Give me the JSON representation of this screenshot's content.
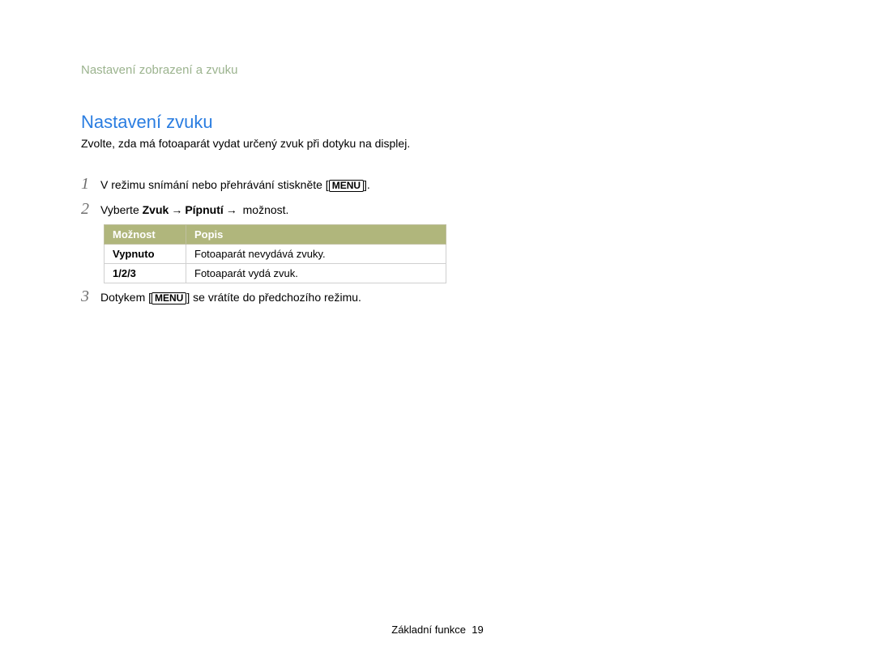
{
  "header": {
    "section": "Nastavení zobrazení a zvuku"
  },
  "content": {
    "heading": "Nastavení zvuku",
    "intro": "Zvolte, zda má fotoaparát vydat určený zvuk při dotyku na displej.",
    "steps": {
      "s1_num": "1",
      "s1_pre": "V režimu snímání nebo přehrávání stiskněte [",
      "s1_menu": "MENU",
      "s1_post": "].",
      "s2_num": "2",
      "s2_pre": "Vyberte ",
      "s2_b1": "Zvuk",
      "s2_arrow1": "→",
      "s2_b2": "Pípnutí",
      "s2_arrow2": "→",
      "s2_post": " možnost.",
      "s3_num": "3",
      "s3_pre": "Dotykem [",
      "s3_menu": "MENU",
      "s3_post": "] se vrátíte do předchozího režimu."
    },
    "table": {
      "h_option": "Možnost",
      "h_desc": "Popis",
      "rows": [
        {
          "option": "Vypnuto",
          "desc": "Fotoaparát nevydává zvuky."
        },
        {
          "option": "1/2/3",
          "desc": "Fotoaparát vydá zvuk."
        }
      ]
    }
  },
  "footer": {
    "chapter": "Základní funkce",
    "page": "19"
  }
}
